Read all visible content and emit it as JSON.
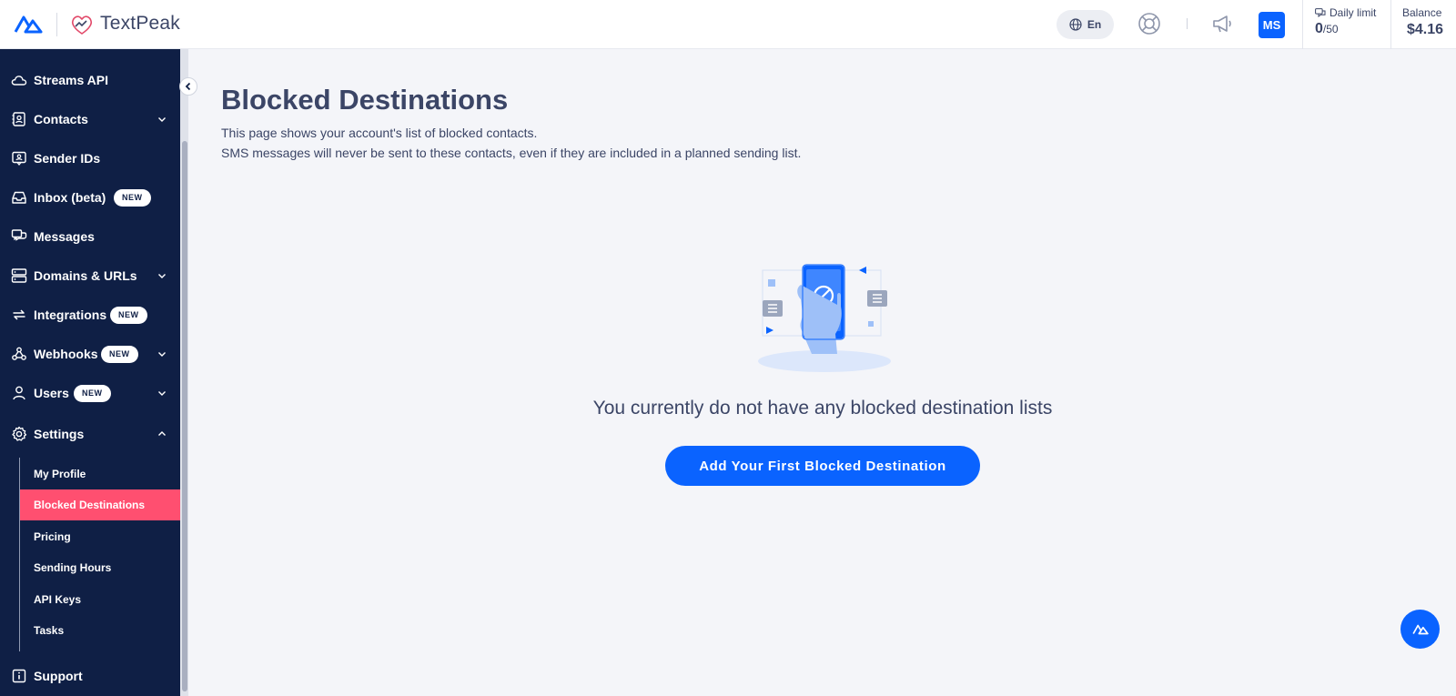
{
  "header": {
    "brand_name": "TextPeak",
    "language": "En",
    "avatar_initials": "MS",
    "daily_limit_label": "Daily limit",
    "daily_limit_used": "0",
    "daily_limit_total": "/50",
    "balance_label": "Balance",
    "balance_value": "$4.16"
  },
  "sidebar": {
    "items": [
      {
        "label": "Streams API",
        "icon": "cloud-icon"
      },
      {
        "label": "Contacts",
        "icon": "contacts-icon",
        "expandable": true
      },
      {
        "label": "Sender IDs",
        "icon": "sender-id-icon"
      },
      {
        "label": "Inbox (beta)",
        "icon": "inbox-icon",
        "badge": "NEW"
      },
      {
        "label": "Messages",
        "icon": "messages-icon"
      },
      {
        "label": "Domains & URLs",
        "icon": "domains-icon",
        "expandable": true
      },
      {
        "label": "Integrations",
        "icon": "integrations-icon",
        "badge": "NEW"
      },
      {
        "label": "Webhooks",
        "icon": "webhooks-icon",
        "badge": "NEW",
        "expandable": true
      },
      {
        "label": "Users",
        "icon": "user-icon",
        "badge": "NEW",
        "expandable": true
      },
      {
        "label": "Settings",
        "icon": "gear-icon",
        "expanded": true
      }
    ],
    "settings_sub": [
      {
        "label": "My Profile"
      },
      {
        "label": "Blocked Destinations",
        "active": true
      },
      {
        "label": "Pricing"
      },
      {
        "label": "Sending Hours"
      },
      {
        "label": "API Keys"
      },
      {
        "label": "Tasks"
      }
    ],
    "support": {
      "label": "Support",
      "icon": "support-icon"
    }
  },
  "main": {
    "title": "Blocked Destinations",
    "description_line1": "This page shows your account's list of blocked contacts.",
    "description_line2": "SMS messages will never be sent to these contacts, even if they are included in a planned sending list.",
    "empty_message": "You currently do not have any blocked destination lists",
    "cta_label": "Add Your First Blocked Destination"
  },
  "colors": {
    "sidebar_bg": "#0f1f45",
    "accent": "#0a63ff",
    "active_item": "#ff4f70",
    "page_bg": "#f4f5f9"
  }
}
